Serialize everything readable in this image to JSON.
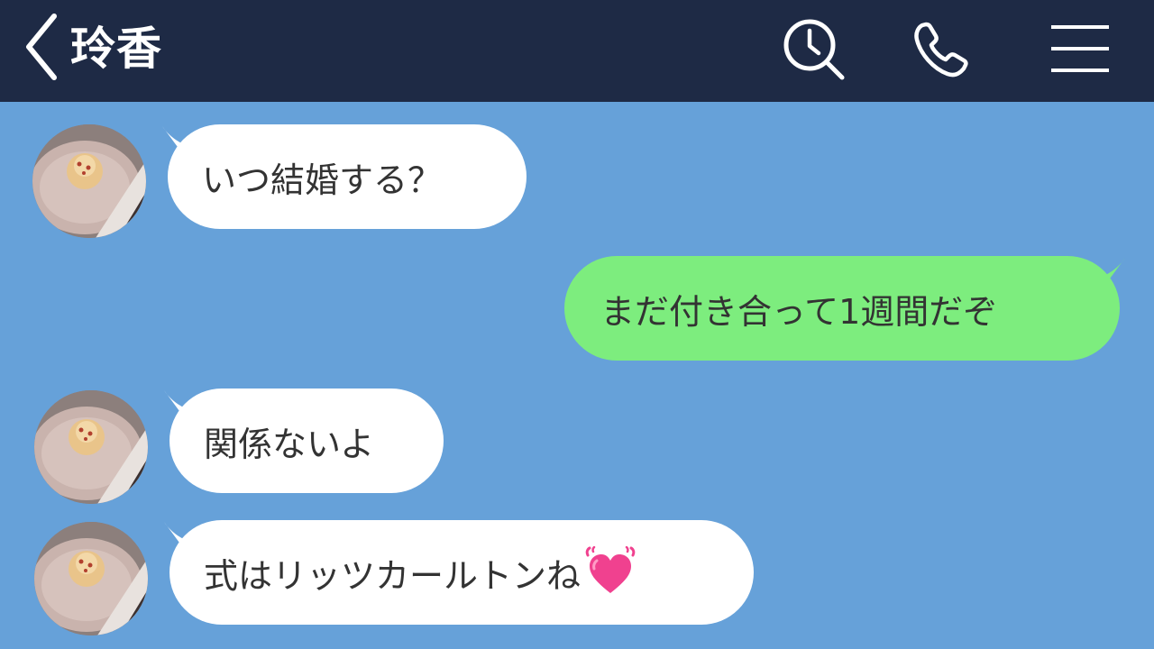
{
  "header": {
    "title": "玲香",
    "back_icon": "chevron-left-icon",
    "search_icon": "clock-search-icon",
    "call_icon": "phone-icon",
    "menu_icon": "hamburger-menu-icon",
    "background_color": "#1e2a45"
  },
  "chat": {
    "background_color": "#66a1d9",
    "incoming_bubble_color": "#ffffff",
    "outgoing_bubble_color": "#7ded7e",
    "messages": [
      {
        "direction": "incoming",
        "text": "いつ結婚する？"
      },
      {
        "direction": "outgoing",
        "text": "まだ付き合って1週間だぞ"
      },
      {
        "direction": "incoming",
        "text": "関係ないよ"
      },
      {
        "direction": "incoming",
        "text": "式はリッツカールトンね",
        "emoji": "pink-heart-emoji"
      }
    ]
  },
  "contact": {
    "avatar_icon": "cupcake-avatar-icon"
  }
}
